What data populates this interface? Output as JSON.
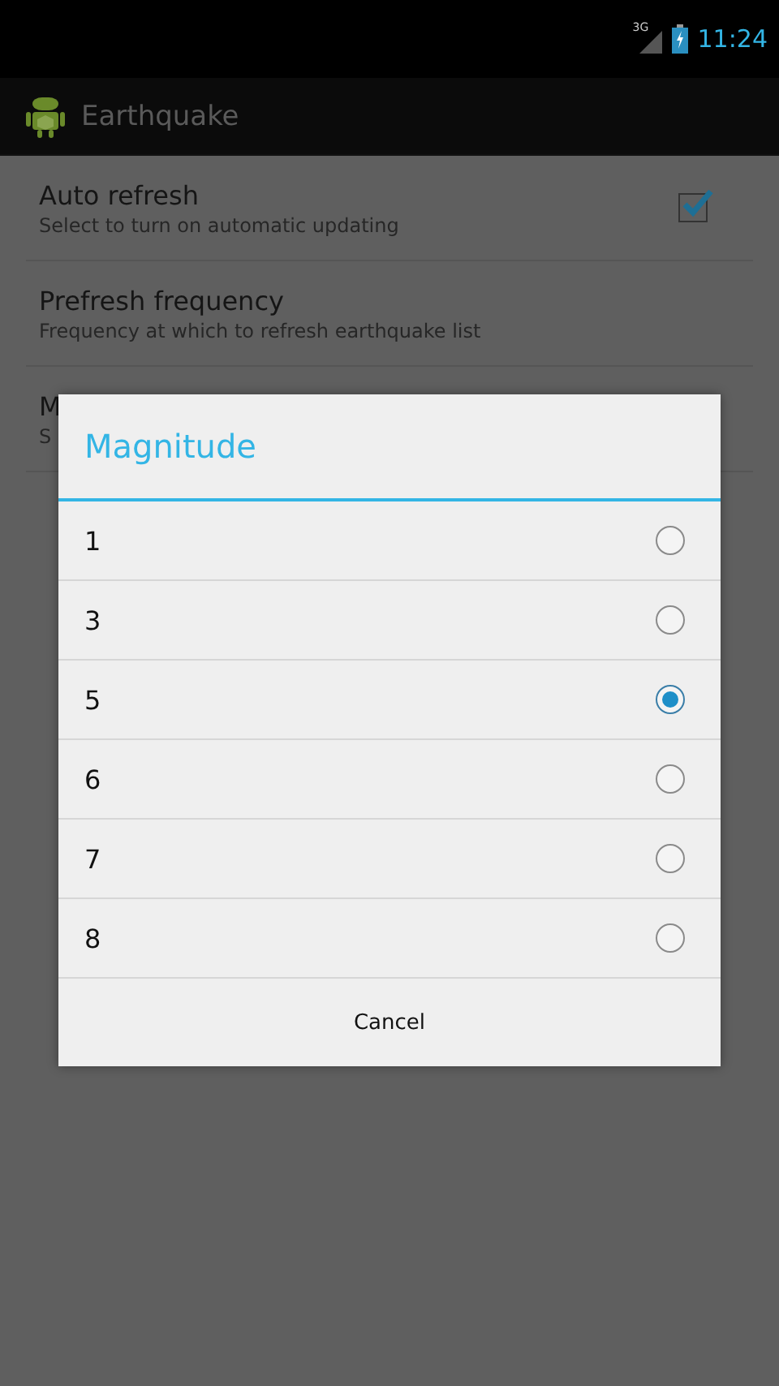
{
  "status_bar": {
    "network": "3G",
    "time": "11:24"
  },
  "action_bar": {
    "title": "Earthquake"
  },
  "preferences": [
    {
      "kind": "checkbox",
      "title": "Auto refresh",
      "summary": "Select to turn on automatic updating",
      "checked": true
    },
    {
      "kind": "plain",
      "title": "Prefresh frequency",
      "summary": "Frequency at which to refresh earthquake list"
    },
    {
      "kind": "plain",
      "title": "M",
      "summary": "S"
    }
  ],
  "dialog": {
    "title": "Magnitude",
    "options": [
      {
        "label": "1",
        "selected": false
      },
      {
        "label": "3",
        "selected": false
      },
      {
        "label": "5",
        "selected": true
      },
      {
        "label": "6",
        "selected": false
      },
      {
        "label": "7",
        "selected": false
      },
      {
        "label": "8",
        "selected": false
      }
    ],
    "cancel": "Cancel"
  }
}
